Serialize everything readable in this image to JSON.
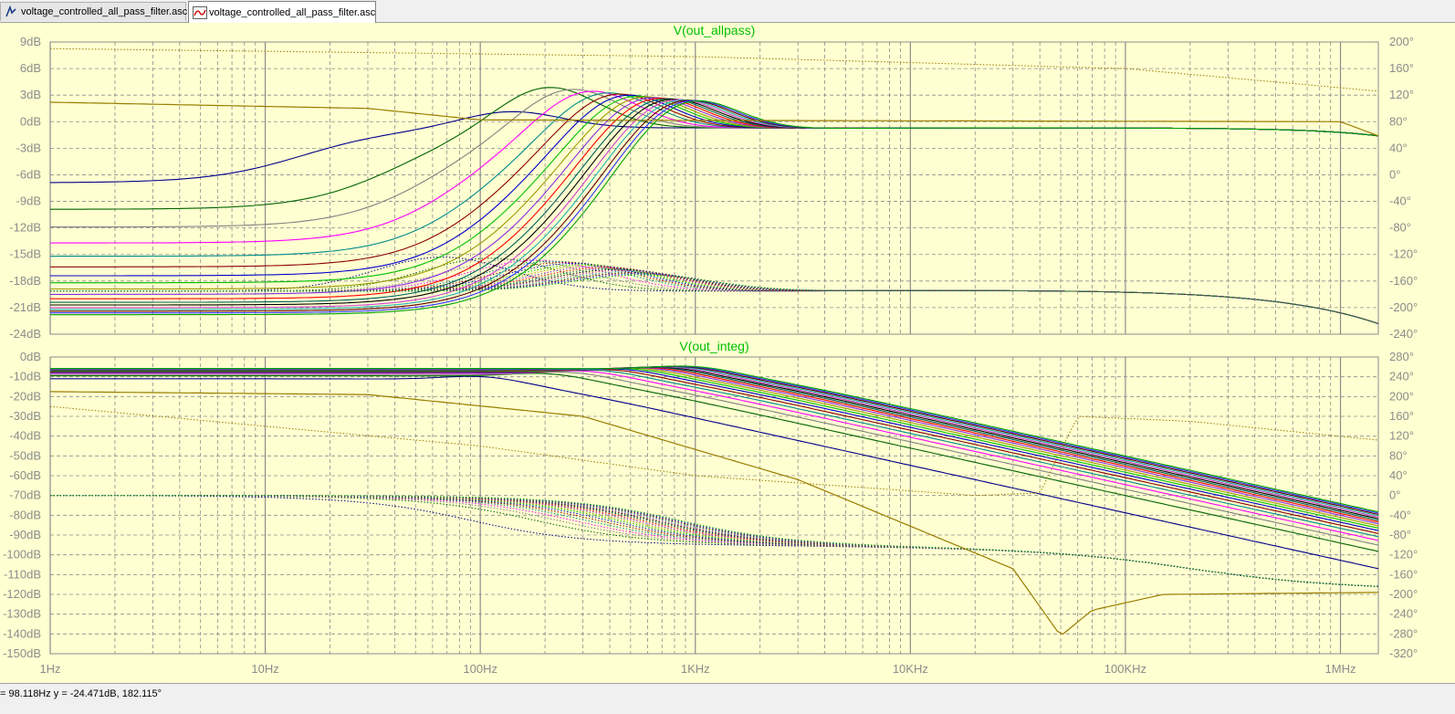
{
  "tabs": [
    {
      "label": "voltage_controlled_all_pass_filter.asc",
      "icon": "schematic-icon"
    },
    {
      "label": "voltage_controlled_all_pass_filter.asc",
      "icon": "waveform-icon"
    }
  ],
  "status": {
    "cursor_readout": "= 98.118Hz   y = -24.471dB, 182.115°"
  },
  "colors": {
    "background": "#ffffd1",
    "grid": "#8c8c8c",
    "title": "#00c000",
    "axis_text": "#8c8c8c"
  },
  "chart_data": [
    {
      "type": "line",
      "title": "V(out_allpass)",
      "xscale": "log",
      "xlim": [
        1,
        1500000
      ],
      "x_ticks": [
        "1Hz",
        "10Hz",
        "100Hz",
        "1KHz",
        "10KHz",
        "100KHz",
        "1MHz"
      ],
      "ylim_left": [
        -24,
        9
      ],
      "y_ticks_left": [
        "9dB",
        "6dB",
        "3dB",
        "0dB",
        "-3dB",
        "-6dB",
        "-9dB",
        "-12dB",
        "-15dB",
        "-18dB",
        "-21dB",
        "-24dB"
      ],
      "ylim_right": [
        -240,
        200
      ],
      "y_ticks_right": [
        "200°",
        "160°",
        "120°",
        "80°",
        "40°",
        "0°",
        "-40°",
        "-80°",
        "-120°",
        "-160°",
        "-200°",
        "-240°"
      ],
      "grid": true,
      "magnitude_family": {
        "low_freq_dB": [
          -6.9,
          -9.9,
          -11.9,
          -13.7,
          -15.2,
          -16.4,
          -17.4,
          -18.2,
          -18.9,
          -19.5,
          -20.0,
          -20.4,
          -20.7,
          -21.0,
          -21.2,
          -21.4,
          -21.6,
          -21.8
        ],
        "corner_hz": [
          15,
          40,
          60,
          80,
          100,
          115,
          130,
          145,
          160,
          175,
          190,
          205,
          220,
          235,
          250,
          265,
          280,
          295
        ],
        "peak_dB": 4.2,
        "hf_dB": -0.7
      },
      "phase_family": {
        "low_freq_deg": -175,
        "bump_deg": -124,
        "hf_deg": -170,
        "end_deg": -224
      },
      "reference_mag": {
        "points": [
          [
            1,
            2.2
          ],
          [
            30,
            1.5
          ],
          [
            100,
            0.2
          ],
          [
            1000000,
            0
          ],
          [
            1500000,
            -1.6
          ]
        ]
      },
      "reference_phase": {
        "points": [
          [
            1,
            190
          ],
          [
            1000,
            178
          ],
          [
            100000,
            160
          ],
          [
            1500000,
            126
          ]
        ]
      }
    },
    {
      "type": "line",
      "title": "V(out_integ)",
      "xscale": "log",
      "xlim": [
        1,
        1500000
      ],
      "x_ticks": [
        "1Hz",
        "10Hz",
        "100Hz",
        "1KHz",
        "10KHz",
        "100KHz",
        "1MHz"
      ],
      "ylim_left": [
        -150,
        0
      ],
      "y_ticks_left": [
        "0dB",
        "-10dB",
        "-20dB",
        "-30dB",
        "-40dB",
        "-50dB",
        "-60dB",
        "-70dB",
        "-80dB",
        "-90dB",
        "-100dB",
        "-110dB",
        "-120dB",
        "-130dB",
        "-140dB",
        "-150dB"
      ],
      "ylim_right": [
        -320,
        280
      ],
      "y_ticks_right": [
        "280°",
        "240°",
        "200°",
        "160°",
        "120°",
        "80°",
        "40°",
        "0°",
        "-40°",
        "-80°",
        "-120°",
        "-160°",
        "-200°",
        "-240°",
        "-280°",
        "-320°"
      ],
      "grid": true,
      "magnitude_family": {
        "low_freq_dB": [
          -11,
          -9.5,
          -8.8,
          -8.2,
          -7.8,
          -7.5,
          -7.2,
          -7.0,
          -6.8,
          -6.6,
          -6.5,
          -6.4,
          -6.3,
          -6.2,
          -6.1,
          -6.0,
          -5.9,
          -5.8
        ],
        "corner_hz": [
          150,
          300,
          380,
          450,
          520,
          590,
          660,
          730,
          800,
          870,
          940,
          1010,
          1080,
          1150,
          1220,
          1290,
          1360,
          1430
        ],
        "hf_floor_dB": -124
      },
      "phase_family": {
        "low_freq_deg": 0,
        "hf_deg": -180
      },
      "reference_mag": {
        "points": [
          [
            1,
            -17.5
          ],
          [
            30,
            -19
          ],
          [
            300,
            -30
          ],
          [
            3000,
            -62
          ],
          [
            30000,
            -107
          ],
          [
            50000,
            -141
          ],
          [
            70000,
            -128
          ],
          [
            150000,
            -120
          ],
          [
            1500000,
            -119
          ]
        ]
      },
      "reference_phase": {
        "points": [
          [
            1,
            180
          ],
          [
            100,
            100
          ],
          [
            1000,
            40
          ],
          [
            20000,
            0
          ],
          [
            40000,
            5
          ],
          [
            60000,
            160
          ],
          [
            200000,
            150
          ],
          [
            1500000,
            112
          ]
        ]
      }
    }
  ]
}
